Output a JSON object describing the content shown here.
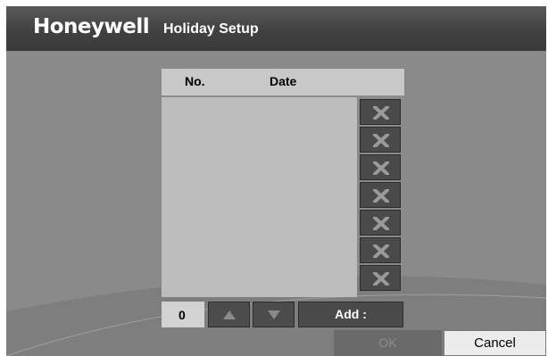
{
  "header": {
    "logo_text": "Honeywell",
    "title": "Holiday Setup"
  },
  "list": {
    "columns": [
      "No.",
      "Date"
    ],
    "rows": [],
    "delete_button_icon": "close-icon",
    "delete_buttons_count": 7
  },
  "controls": {
    "count_value": "0",
    "up_icon": "triangle-up-icon",
    "down_icon": "triangle-down-icon",
    "add_label": "Add :"
  },
  "footer": {
    "ok_label": "OK",
    "cancel_label": "Cancel"
  },
  "colors": {
    "title_bar": "#414141",
    "background": "#8a8a8a",
    "list_body": "#bdbdbd",
    "button_dark": "#4a4a4a",
    "icon_gray": "#9a9a9a"
  }
}
